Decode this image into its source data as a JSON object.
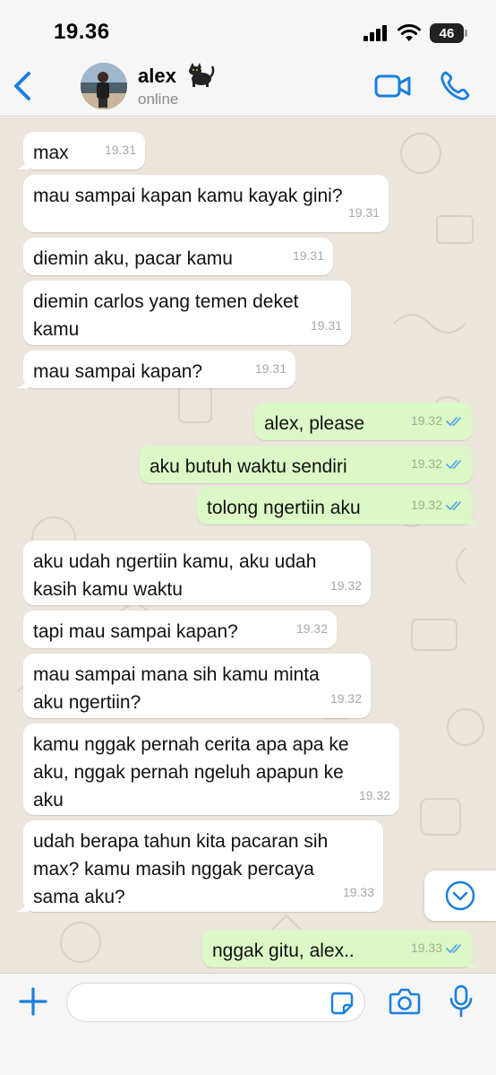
{
  "status_bar": {
    "time": "19.36",
    "battery": "46"
  },
  "header": {
    "contact_name": "alex",
    "contact_emoji": "black-cat",
    "contact_status": "online",
    "icons": {
      "back": "chevron-left-icon",
      "video": "video-camera-icon",
      "phone": "phone-icon"
    }
  },
  "messages": [
    {
      "dir": "in",
      "text": "max",
      "time": "19.31"
    },
    {
      "dir": "in",
      "text": "mau sampai kapan kamu kayak gini?",
      "time": "19.31"
    },
    {
      "dir": "in",
      "text": "diemin aku, pacar kamu",
      "time": "19.31"
    },
    {
      "dir": "in",
      "text": "diemin carlos yang temen deket\nkamu",
      "time": "19.31"
    },
    {
      "dir": "in",
      "text": "mau sampai kapan?",
      "time": "19.31"
    },
    {
      "dir": "out",
      "text": "alex, please",
      "time": "19.32",
      "read": true
    },
    {
      "dir": "out",
      "text": "aku butuh waktu sendiri",
      "time": "19.32",
      "read": true
    },
    {
      "dir": "out",
      "text": "tolong ngertiin aku",
      "time": "19.32",
      "read": true
    },
    {
      "dir": "in",
      "text": "aku udah ngertiin kamu, aku udah\nkasih kamu waktu",
      "time": "19.32"
    },
    {
      "dir": "in",
      "text": "tapi mau sampai kapan?",
      "time": "19.32"
    },
    {
      "dir": "in",
      "text": "mau sampai mana sih kamu minta\naku ngertiin?",
      "time": "19.32"
    },
    {
      "dir": "in",
      "text": "kamu nggak pernah cerita apa apa ke\naku, nggak pernah ngeluh apapun ke\naku",
      "time": "19.32"
    },
    {
      "dir": "in",
      "text": "udah berapa tahun kita pacaran sih\nmax? kamu masih nggak percaya\nsama aku?",
      "time": "19.33"
    },
    {
      "dir": "out",
      "text": "nggak gitu, alex..",
      "time": "19.33",
      "read": true
    }
  ],
  "composer": {
    "placeholder": "",
    "icons": {
      "plus": "plus-icon",
      "sticker": "sticker-icon",
      "camera": "camera-icon",
      "mic": "microphone-icon"
    }
  },
  "colors": {
    "accent": "#1a7fe0",
    "incoming": "#ffffff",
    "outgoing": "#dbf8c6",
    "wallpaper": "#ece5dc",
    "read_ticks": "#4fa3e8"
  }
}
